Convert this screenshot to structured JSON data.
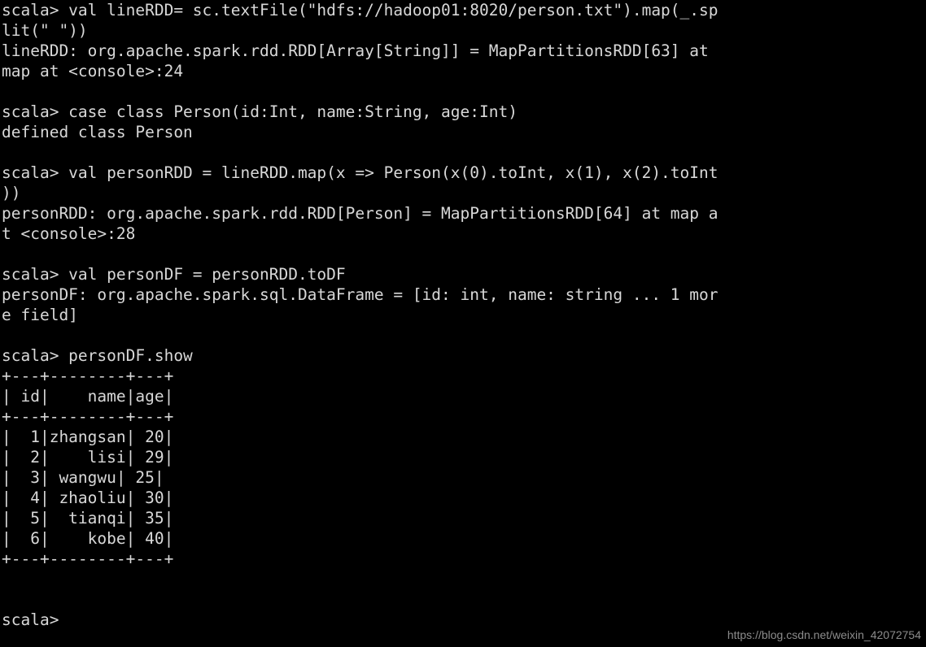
{
  "terminal": {
    "title": "Spark Scala REPL",
    "shell_name": "scala",
    "prompt": "scala> ",
    "background_color": "#000000",
    "foreground_color": "#d8d8d8",
    "cursor_color": "#e9e9e9",
    "columns": 75,
    "rows": 32,
    "cursor": {
      "row": 31,
      "column": 7,
      "shape": "block"
    }
  },
  "watermark": {
    "text": "https://blog.csdn.net/weixin_42072754",
    "color": "#8c8c8c"
  },
  "lines": [
    "scala> val lineRDD= sc.textFile(\"hdfs://hadoop01:8020/person.txt\").map(_.sp",
    "lit(\" \"))",
    "lineRDD: org.apache.spark.rdd.RDD[Array[String]] = MapPartitionsRDD[63] at ",
    "map at <console>:24",
    "",
    "scala> case class Person(id:Int, name:String, age:Int)",
    "defined class Person",
    "",
    "scala> val personRDD = lineRDD.map(x => Person(x(0).toInt, x(1), x(2).toInt",
    "))",
    "personRDD: org.apache.spark.rdd.RDD[Person] = MapPartitionsRDD[64] at map a",
    "t <console>:28",
    "",
    "scala> val personDF = personRDD.toDF",
    "personDF: org.apache.spark.sql.DataFrame = [id: int, name: string ... 1 mor",
    "e field]",
    "",
    "scala> personDF.show",
    "+---+--------+---+",
    "| id|    name|age|",
    "+---+--------+---+",
    "|  1|zhangsan| 20|",
    "|  2|    lisi| 29|",
    "|  3| wangwu| 25|",
    "|  4| zhaoliu| 30|",
    "|  5|  tianqi| 35|",
    "|  6|    kobe| 40|",
    "+---+--------+---+",
    "",
    "",
    "scala> "
  ],
  "commands": [
    {
      "prompt": "scala> ",
      "input": "val lineRDD= sc.textFile(\"hdfs://hadoop01:8020/person.txt\").map(_.split(\" \"))",
      "output": "lineRDD: org.apache.spark.rdd.RDD[Array[String]] = MapPartitionsRDD[63] at map at <console>:24"
    },
    {
      "prompt": "scala> ",
      "input": "case class Person(id:Int, name:String, age:Int)",
      "output": "defined class Person"
    },
    {
      "prompt": "scala> ",
      "input": "val personRDD = lineRDD.map(x => Person(x(0).toInt, x(1), x(2).toInt))",
      "output": "personRDD: org.apache.spark.rdd.RDD[Person] = MapPartitionsRDD[64] at map at <console>:28"
    },
    {
      "prompt": "scala> ",
      "input": "val personDF = personRDD.toDF",
      "output": "personDF: org.apache.spark.sql.DataFrame = [id: int, name: string ... 1 more field]"
    },
    {
      "prompt": "scala> ",
      "input": "personDF.show",
      "output": "dataframe table"
    }
  ],
  "dataframe": {
    "columns": [
      "id",
      "name",
      "age"
    ],
    "column_types": [
      "int",
      "string",
      "int"
    ],
    "rows": [
      [
        "1",
        "zhangsan",
        "20"
      ],
      [
        "2",
        "lisi",
        "29"
      ],
      [
        "3",
        "wangwu",
        "25"
      ],
      [
        "4",
        "zhaoliu",
        "30"
      ],
      [
        "5",
        "tianqi",
        "35"
      ],
      [
        "6",
        "kobe",
        "40"
      ]
    ],
    "border": "+---+--------+---+",
    "header_row": "| id|    name|age|"
  }
}
